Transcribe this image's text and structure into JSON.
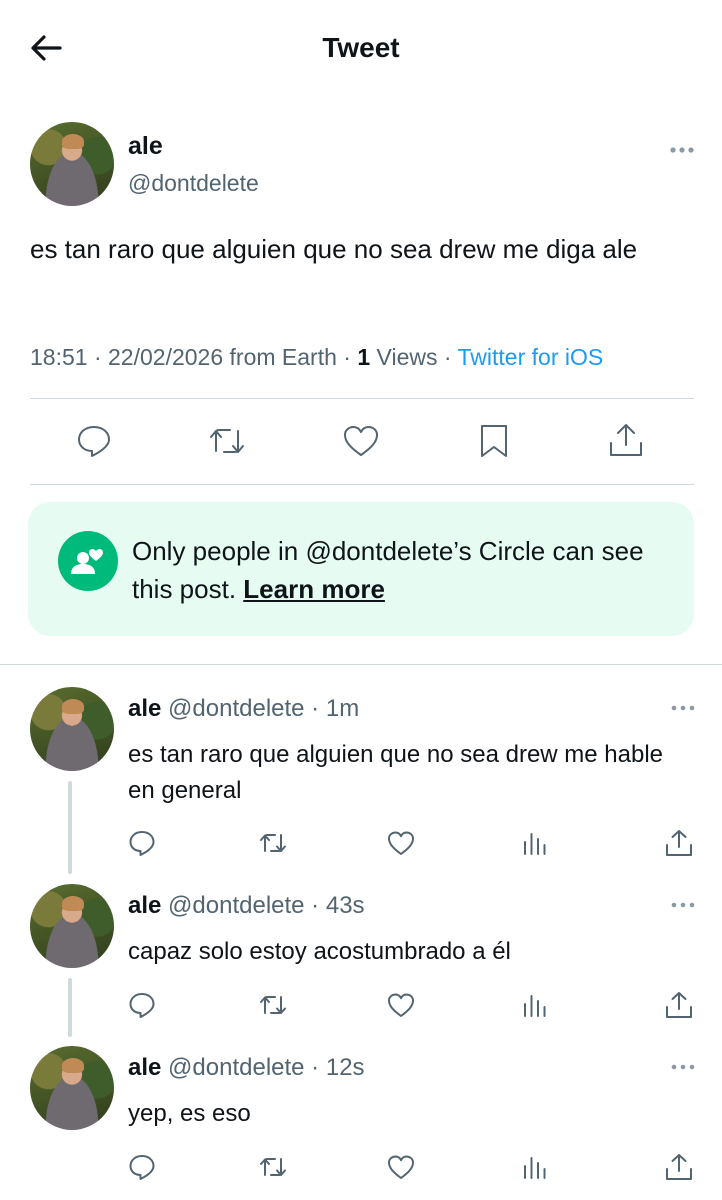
{
  "header": {
    "title": "Tweet"
  },
  "main_tweet": {
    "name": "ale",
    "handle": "@dontdelete",
    "text": "es tan raro que alguien que no sea drew me diga ale",
    "time": "18:51",
    "date": "22/02/2026",
    "location": "from Earth",
    "views_count": "1",
    "views_label": "Views",
    "source": "Twitter for iOS"
  },
  "circle_notice": {
    "text": "Only people in @dontdelete’s Circle can see this post.",
    "link": "Learn more"
  },
  "replies": [
    {
      "name": "ale",
      "meta": "@dontdelete · 1m",
      "text": "es tan raro que alguien que no sea drew me hable en general"
    },
    {
      "name": "ale",
      "meta": "@dontdelete · 43s",
      "text": "capaz solo estoy acostumbrado a él"
    },
    {
      "name": "ale",
      "meta": "@dontdelete · 12s",
      "text": "yep, es eso"
    }
  ],
  "icons": {
    "back": "arrow-left-icon",
    "more": "more-horizontal-icon",
    "reply": "reply-icon",
    "retweet": "retweet-icon",
    "like": "heart-icon",
    "bookmark": "bookmark-icon",
    "share": "share-icon",
    "views": "views-icon",
    "circle": "circle-people-icon"
  },
  "colors": {
    "accent": "#1d9bf0",
    "circle_green": "#00ba7c",
    "circle_bg": "#e6fcf2",
    "secondary_text": "#536471",
    "divider": "#cfd9de"
  }
}
